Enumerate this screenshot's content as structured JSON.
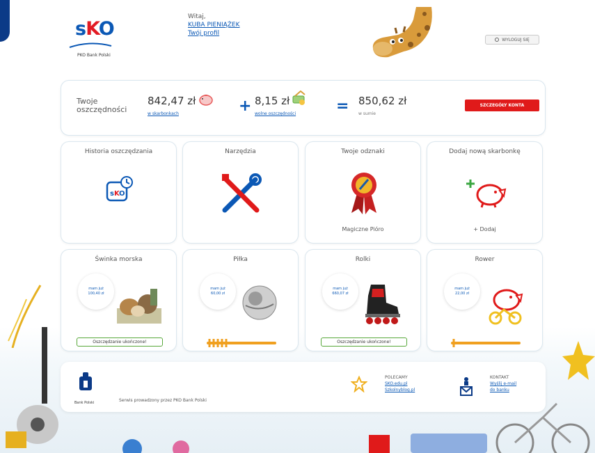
{
  "header": {
    "logo": {
      "text_s": "s",
      "text_k": "K",
      "text_o": "O",
      "subtitle": "PKO Bank Polski"
    },
    "greeting": "Witaj,",
    "user_name": "KUBA PIENIĄŻEK",
    "profile_link": "Twój profil",
    "logout_label": "WYLOGUJ SIĘ"
  },
  "savings": {
    "label": "Twoje oszczędności",
    "piggy_amount": "842,47 zł",
    "piggy_sub": "w skarbonkach",
    "free_amount": "8,15 zł",
    "free_sub": "wolne oszczędności",
    "total_amount": "850,62 zł",
    "total_sub": "w sumie",
    "plus": "+",
    "equals": "=",
    "details_button": "SZCZEGÓŁY KONTA"
  },
  "tiles": [
    {
      "title": "Historia oszczędzania",
      "footer": ""
    },
    {
      "title": "Narzędzia",
      "footer": ""
    },
    {
      "title": "Twoje odznaki",
      "footer": "Magiczne Pióro"
    },
    {
      "title": "Dodaj nową skarbonkę",
      "footer": "+ Dodaj"
    }
  ],
  "piggybanks": [
    {
      "title": "Świnka morska",
      "bubble_l1": "mam już",
      "bubble_l2": "100,40 zł",
      "status": "Oszczędzanie ukończone!"
    },
    {
      "title": "Piłka",
      "bubble_l1": "mam już",
      "bubble_l2": "60,00 zł",
      "status": "",
      "progress": 0.3
    },
    {
      "title": "Rolki",
      "bubble_l1": "mam już",
      "bubble_l2": "660,07 zł",
      "status": "Oszczędzanie ukończone!"
    },
    {
      "title": "Rower",
      "bubble_l1": "mam już",
      "bubble_l2": "22,00 zł",
      "status": "",
      "progress": 0.1
    }
  ],
  "footer": {
    "pko_label": "Bank Polski",
    "service_text": "Serwis prowadzony przez PKO Bank Polski",
    "recommend_heading": "POLECAMY",
    "recommend_link1": "SKO.edu.pl",
    "recommend_link2": "Szkolnyblog.pl",
    "contact_heading": "KONTAKT",
    "contact_link1": "Wyślij e-mail",
    "contact_link2": "do banku"
  },
  "colors": {
    "brand_blue": "#0b58b5",
    "brand_red": "#e01a1a",
    "success_green": "#58a83a",
    "accent_orange": "#f0a020"
  }
}
